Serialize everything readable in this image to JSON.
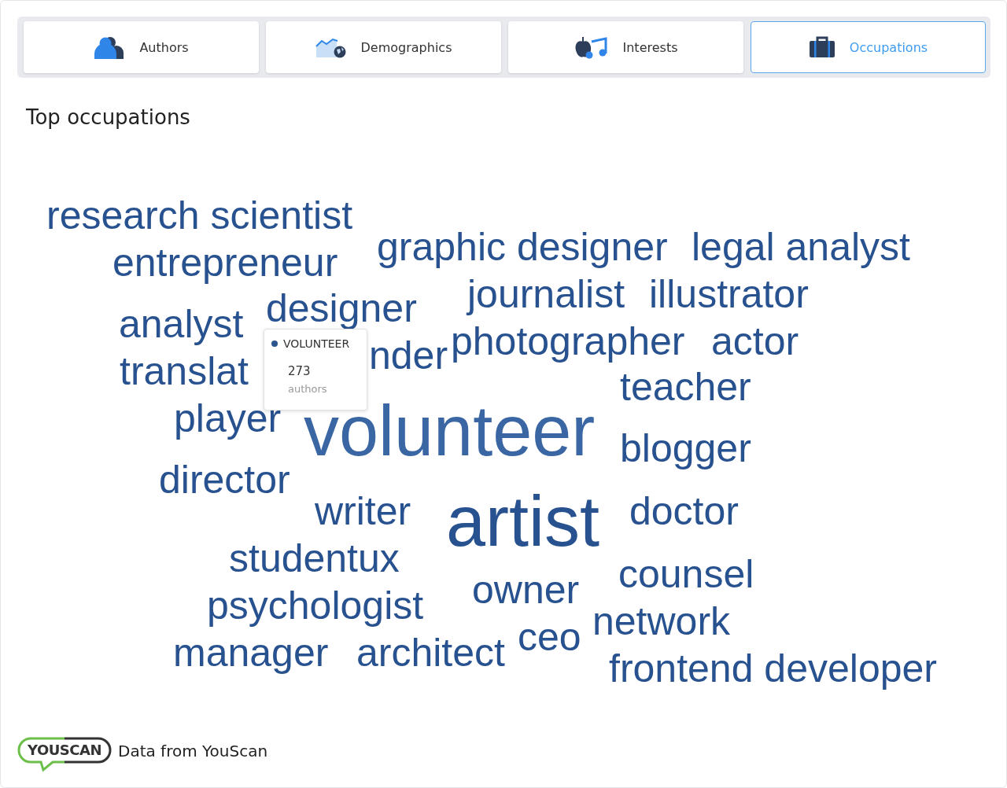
{
  "tabs": [
    {
      "label": "Authors",
      "kind": "authors",
      "selected": false
    },
    {
      "label": "Demographics",
      "kind": "demographics",
      "selected": false
    },
    {
      "label": "Interests",
      "kind": "interests",
      "selected": false
    },
    {
      "label": "Occupations",
      "kind": "occupations",
      "selected": true
    }
  ],
  "heading": "Top occupations",
  "cloud": {
    "words": [
      {
        "text": "research scientist",
        "kind": "normal",
        "highlighted": false
      },
      {
        "text": "entrepreneur",
        "kind": "normal",
        "highlighted": false
      },
      {
        "text": "graphic designer",
        "kind": "normal",
        "highlighted": false
      },
      {
        "text": "legal analyst",
        "kind": "normal",
        "highlighted": false
      },
      {
        "text": "journalist",
        "kind": "normal",
        "highlighted": false
      },
      {
        "text": "illustrator",
        "kind": "normal",
        "highlighted": false
      },
      {
        "text": "designer",
        "kind": "normal",
        "highlighted": false
      },
      {
        "text": "analyst",
        "kind": "normal",
        "highlighted": false
      },
      {
        "text": "photographer",
        "kind": "normal",
        "highlighted": false
      },
      {
        "text": "actor",
        "kind": "normal",
        "highlighted": false
      },
      {
        "text": "translat",
        "kind": "normal",
        "highlighted": false
      },
      {
        "text": "nder",
        "kind": "normal",
        "highlighted": false
      },
      {
        "text": "teacher",
        "kind": "normal",
        "highlighted": false
      },
      {
        "text": "player",
        "kind": "normal",
        "highlighted": false
      },
      {
        "text": "volunteer",
        "kind": "large",
        "highlighted": true
      },
      {
        "text": "blogger",
        "kind": "normal",
        "highlighted": false
      },
      {
        "text": "director",
        "kind": "normal",
        "highlighted": false
      },
      {
        "text": "writer",
        "kind": "normal",
        "highlighted": false
      },
      {
        "text": "artist",
        "kind": "large",
        "highlighted": false
      },
      {
        "text": "doctor",
        "kind": "normal",
        "highlighted": false
      },
      {
        "text": "studentux",
        "kind": "normal",
        "highlighted": false
      },
      {
        "text": "counsel",
        "kind": "normal",
        "highlighted": false
      },
      {
        "text": "psychologist",
        "kind": "normal",
        "highlighted": false
      },
      {
        "text": "owner",
        "kind": "normal",
        "highlighted": false
      },
      {
        "text": "network",
        "kind": "normal",
        "highlighted": false
      },
      {
        "text": "ceo",
        "kind": "normal",
        "highlighted": false
      },
      {
        "text": "manager",
        "kind": "normal",
        "highlighted": false
      },
      {
        "text": "architect",
        "kind": "normal",
        "highlighted": false
      },
      {
        "text": "frontend developer",
        "kind": "normal",
        "highlighted": false
      }
    ],
    "tooltip": {
      "title": "VOLUNTEER",
      "color": "#2a5590",
      "count": "273",
      "unit": "authors"
    }
  },
  "footer": {
    "logo": "YOUSCAN",
    "text": "Data from YouScan"
  }
}
